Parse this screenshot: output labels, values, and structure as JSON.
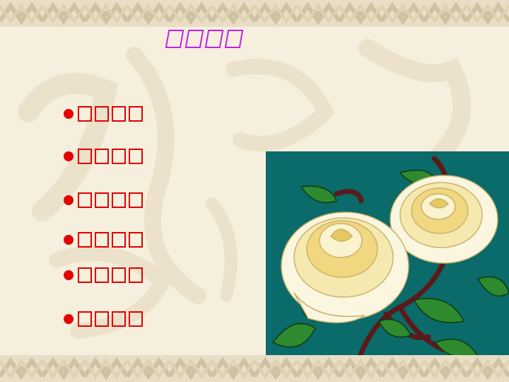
{
  "slide": {
    "title": "",
    "bullets": [
      {
        "text": ""
      },
      {
        "text": ""
      },
      {
        "text": ""
      },
      {
        "text": ""
      },
      {
        "text": ""
      },
      {
        "text": ""
      }
    ]
  },
  "colors": {
    "background": "#f6efdd",
    "title": "#c020e6",
    "bullet": "#e60000",
    "image_background": "#0b6a6a",
    "rose_petal": "#fbf3cf",
    "rose_center": "#f0d780",
    "leaf": "#2e8a2e",
    "stem": "#5a1a1a"
  },
  "icons": [
    "bullet-dot-icon",
    "rose-illustration"
  ]
}
